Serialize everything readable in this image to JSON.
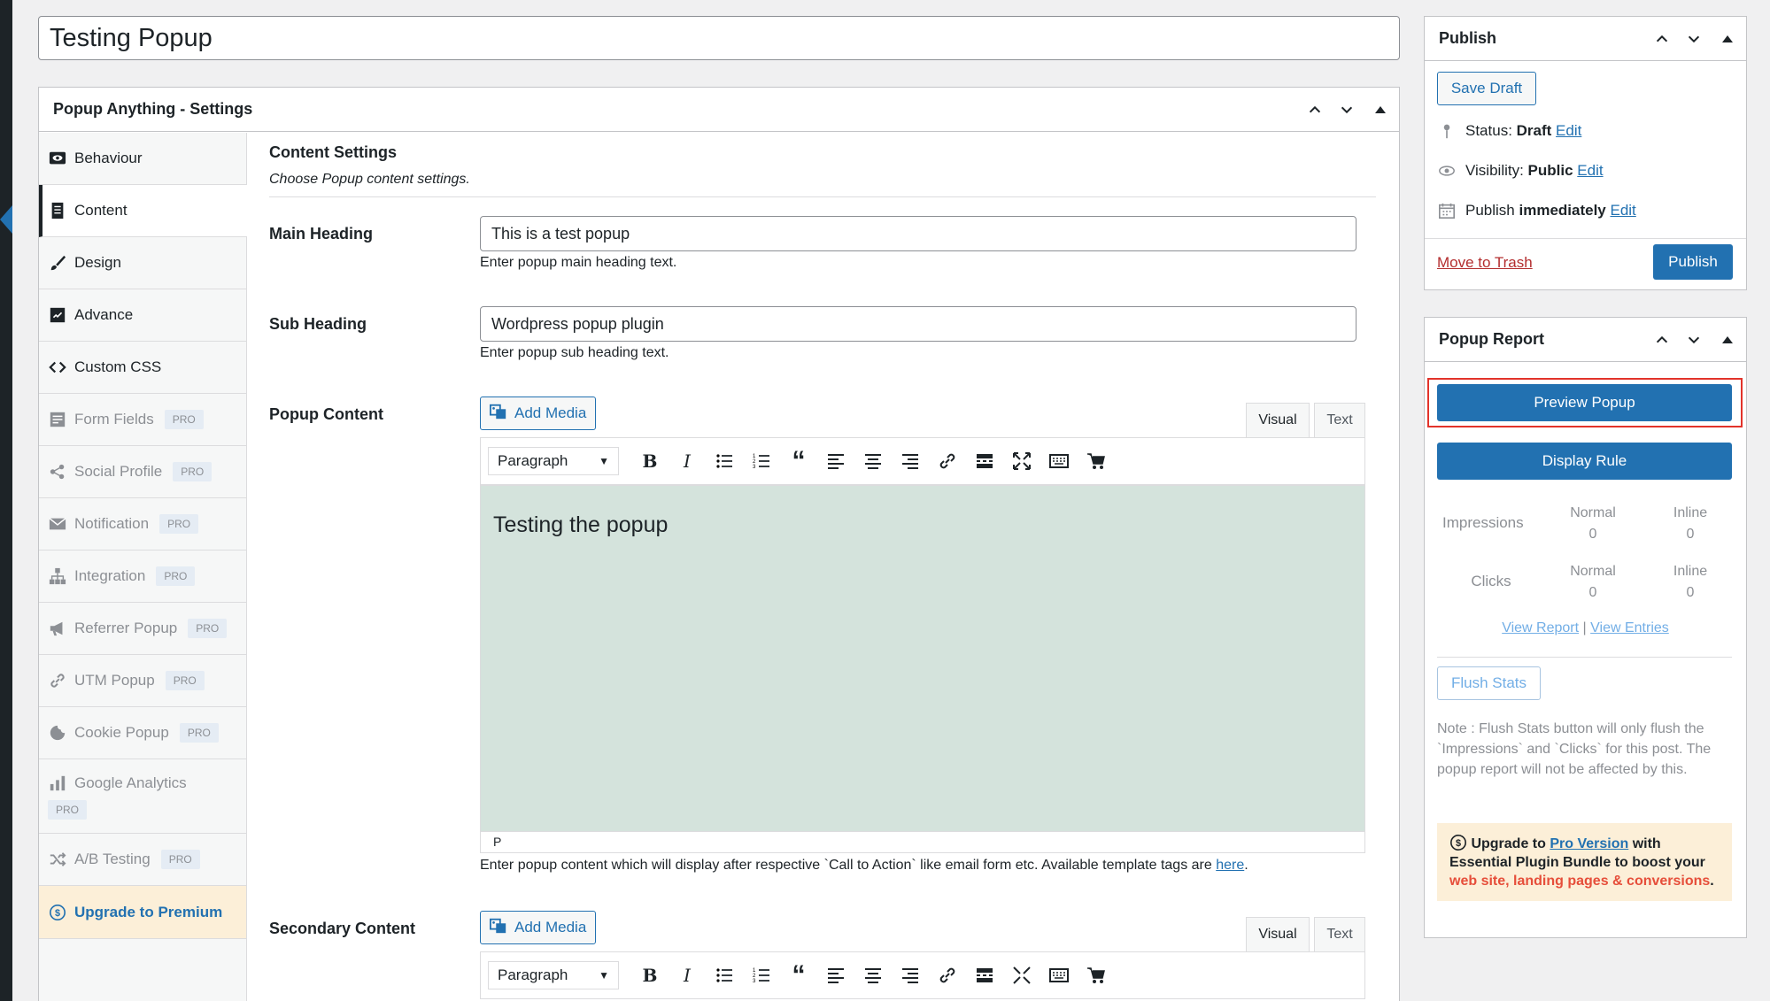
{
  "post_title": "Testing Popup",
  "settings_box": {
    "title": "Popup Anything - Settings",
    "tabs": [
      {
        "label": "Behaviour",
        "icon": "eye-icon",
        "pro": false
      },
      {
        "label": "Content",
        "icon": "document-icon",
        "pro": false
      },
      {
        "label": "Design",
        "icon": "brush-icon",
        "pro": false
      },
      {
        "label": "Advance",
        "icon": "advance-icon",
        "pro": false
      },
      {
        "label": "Custom CSS",
        "icon": "code-icon",
        "pro": false
      },
      {
        "label": "Form Fields",
        "icon": "form-icon",
        "pro": true
      },
      {
        "label": "Social Profile",
        "icon": "share-icon",
        "pro": true
      },
      {
        "label": "Notification",
        "icon": "mail-icon",
        "pro": true
      },
      {
        "label": "Integration",
        "icon": "network-icon",
        "pro": true
      },
      {
        "label": "Referrer Popup",
        "icon": "megaphone-icon",
        "pro": true
      },
      {
        "label": "UTM Popup",
        "icon": "link-icon",
        "pro": true
      },
      {
        "label": "Cookie Popup",
        "icon": "cookie-icon",
        "pro": true
      },
      {
        "label": "Google Analytics",
        "icon": "chart-icon",
        "pro": true
      },
      {
        "label": "A/B Testing",
        "icon": "shuffle-icon",
        "pro": true
      }
    ],
    "pro_badge": "PRO",
    "upgrade_tab": "Upgrade to Premium",
    "content": {
      "section_title": "Content Settings",
      "section_desc": "Choose Popup content settings.",
      "main_heading": {
        "label": "Main Heading",
        "value": "This is a test popup",
        "desc": "Enter popup main heading text."
      },
      "sub_heading": {
        "label": "Sub Heading",
        "value": "Wordpress popup plugin",
        "desc": "Enter popup sub heading text."
      },
      "popup_content": {
        "label": "Popup Content",
        "add_media": "Add Media",
        "tab_visual": "Visual",
        "tab_text": "Text",
        "format": "Paragraph",
        "body": "Testing the popup",
        "path": "P",
        "desc": "Enter popup content which will display after respective `Call to Action` like email form etc. Available template tags are ",
        "desc_link": "here",
        "desc_end": "."
      },
      "secondary_content": {
        "label": "Secondary Content",
        "add_media": "Add Media",
        "tab_visual": "Visual",
        "tab_text": "Text",
        "format": "Paragraph"
      }
    }
  },
  "publish_box": {
    "title": "Publish",
    "save_draft": "Save Draft",
    "status_label": "Status: ",
    "status_value": "Draft",
    "visibility_label": "Visibility: ",
    "visibility_value": "Public",
    "publish_label": "Publish ",
    "publish_value": "immediately",
    "edit": "Edit",
    "move_to_trash": "Move to Trash",
    "publish_button": "Publish"
  },
  "report_box": {
    "title": "Popup Report",
    "preview_button": "Preview Popup",
    "display_rule_button": "Display Rule",
    "impressions_label": "Impressions",
    "clicks_label": "Clicks",
    "normal_label": "Normal",
    "inline_label": "Inline",
    "impressions_normal": "0",
    "impressions_inline": "0",
    "clicks_normal": "0",
    "clicks_inline": "0",
    "view_report": "View Report",
    "separator": "|",
    "view_entries": "View Entries",
    "flush_stats": "Flush Stats",
    "note": "Note : Flush Stats button will only flush the `Impressions` and `Clicks` for this post. The popup report will not be affected by this.",
    "upgrade_prefix": "Upgrade to ",
    "upgrade_link": "Pro Version",
    "upgrade_mid": " with Essential Plugin Bundle to boost your ",
    "upgrade_red": "web site, landing pages & conversions",
    "upgrade_end": "."
  },
  "colors": {
    "accent": "#2271b1",
    "highlight": "#e2332a",
    "editor_bg": "#d4e3dc",
    "upgrade_bg": "#fcefd8"
  }
}
